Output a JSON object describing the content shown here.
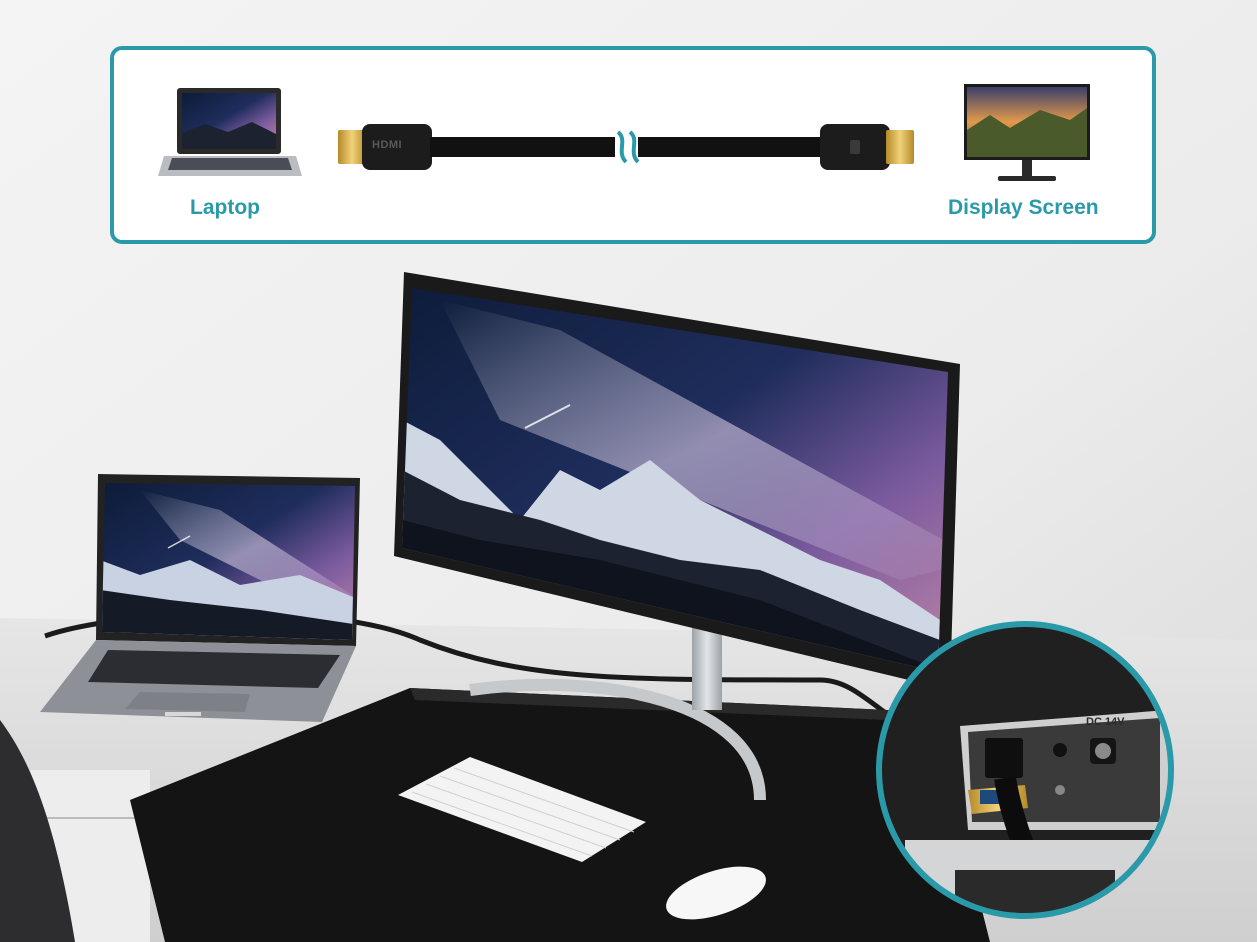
{
  "diagram": {
    "source_label": "Laptop",
    "target_label": "Display Screen",
    "connector_brand": "HDMI",
    "accent_color": "#2a9aa9"
  },
  "closeup": {
    "power_port_label": "DC 14V"
  },
  "scene": {
    "objects": [
      "laptop",
      "ultrawide-monitor",
      "keyboard",
      "mouse",
      "desk-mat",
      "hdmi-cable"
    ]
  }
}
